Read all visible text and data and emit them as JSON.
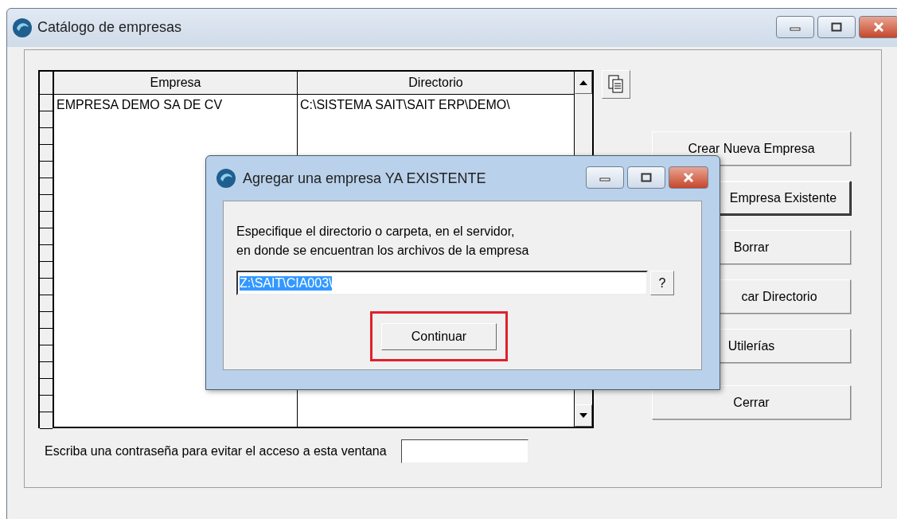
{
  "window": {
    "title": "Catálogo de empresas"
  },
  "table": {
    "columns": [
      "Empresa",
      "Directorio"
    ],
    "rows": [
      [
        "EMPRESA DEMO SA DE CV",
        "C:\\SISTEMA SAIT\\SAIT ERP\\DEMO\\"
      ]
    ]
  },
  "buttons": [
    {
      "label": "Crear Nueva Empresa",
      "default": false
    },
    {
      "label": "Empresa Existente",
      "default": true
    },
    {
      "label": "Borrar",
      "default": false
    },
    {
      "label": "car Directorio",
      "default": false
    },
    {
      "label": "Utilerías",
      "default": false
    },
    {
      "label": "Cerrar",
      "default": false
    }
  ],
  "password": {
    "label": "Escriba una contraseña para evitar el acceso a esta ventana"
  },
  "dialog": {
    "title": "Agregar una empresa YA EXISTENTE",
    "message": [
      "Especifique el directorio o carpeta, en el servidor,",
      "en donde se encuentran los archivos de la empresa"
    ],
    "path": {
      "value": "Z:\\SAIT\\CIA003\\",
      "selected": true
    },
    "help": "?",
    "button": "Continuar"
  }
}
